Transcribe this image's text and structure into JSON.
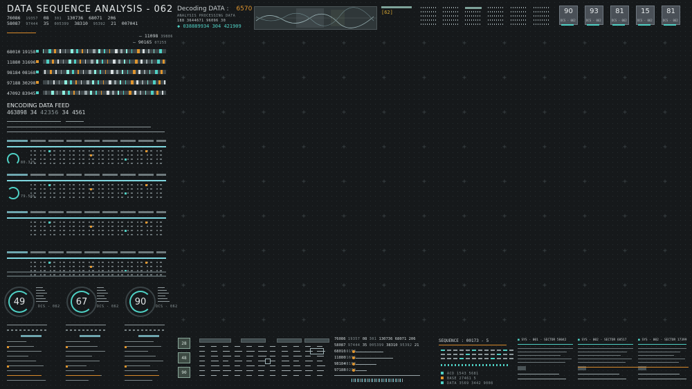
{
  "header": {
    "title": "DATA SEQUENCE ANALYSIS - 062",
    "num_row1": [
      "76086",
      "19357",
      "08",
      "301",
      "130736",
      "68071",
      "206"
    ],
    "num_row2": [
      "58087",
      "97444",
      "35",
      "005399",
      "38310",
      "95392",
      "21",
      "007041"
    ]
  },
  "decoding": {
    "label": "Decoding DATA",
    "sep": ":",
    "value": "6570",
    "sub": "ANALYSIS PROCESSING DATA",
    "nums": "188  3644671  96096  30",
    "code": "038889934 304 421909",
    "badge": "[62]"
  },
  "cards": [
    {
      "value": "90",
      "label": "DCS - 062"
    },
    {
      "value": "93",
      "label": "DCS - 062"
    },
    {
      "value": "81",
      "label": "DCS - 062"
    },
    {
      "value": "15",
      "label": "DCS - 062"
    },
    {
      "value": "81",
      "label": "DCS - 062"
    }
  ],
  "left_top": {
    "right_nums": [
      {
        "a": "11098",
        "b": "39886"
      },
      {
        "a": "90165",
        "b": "07255"
      }
    ],
    "rows": [
      {
        "a": "68010",
        "b": "19158"
      },
      {
        "a": "11880",
        "b": "31696"
      },
      {
        "a": "98184",
        "b": "08168"
      },
      {
        "a": "97188",
        "b": "30298"
      },
      {
        "a": "47092",
        "b": "83945"
      }
    ]
  },
  "encoding": {
    "label": "ENCODING DATA FEED",
    "nums": [
      "463898",
      "34",
      "42356",
      "34",
      "4561"
    ]
  },
  "left_gauges_small": [
    {
      "label": "80.32%"
    },
    {
      "label": "79.56%"
    }
  ],
  "gauges": [
    {
      "value": "49",
      "label": "DCS - 062"
    },
    {
      "value": "67",
      "label": "DCS - 062"
    },
    {
      "value": "90",
      "label": "DCS - 062"
    }
  ],
  "bottom_tiles": [
    {
      "value": "28"
    },
    {
      "value": "48"
    },
    {
      "value": "90"
    }
  ],
  "bottom_center": {
    "rows": [
      {
        "a": "76086",
        "b": "19357",
        "c": "08",
        "d": "301",
        "e": "130736",
        "f": "68071",
        "g": "206"
      },
      {
        "a": "58087",
        "b": "97444",
        "c": "35",
        "d": "005399",
        "e": "38310",
        "f": "95392",
        "g": "21"
      },
      {
        "a": "68010",
        "b": "19158"
      },
      {
        "a": "11880",
        "b": "31696"
      },
      {
        "a": "98184",
        "b": "08168"
      },
      {
        "a": "97188",
        "b": "30298"
      }
    ]
  },
  "sequence": {
    "label": "SEQUENCE",
    "value": "00173 - 5",
    "items": [
      "ACD  1543 5681",
      "BASE  27461 5",
      "DATA  3569  3442 9008"
    ]
  },
  "sys": [
    "SYS - 001 - SECTOR 58042",
    "SYS - 002 - SECTOR 68517",
    "SYS - 002 - SECTOR 17399"
  ],
  "colors": {
    "accent": "#4fd1c5",
    "orange": "#e0962f",
    "background": "#16191b"
  }
}
